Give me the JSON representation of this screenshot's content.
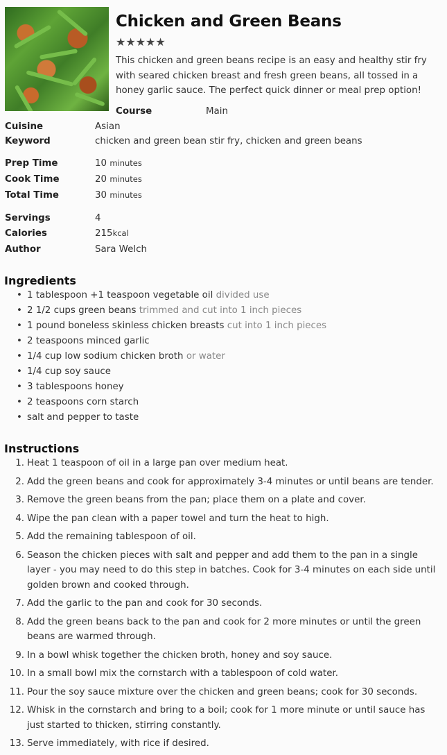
{
  "recipe": {
    "title": "Chicken and Green Beans",
    "rating_stars": "★★★★★",
    "summary": "This chicken and green beans recipe is an easy and healthy stir fry with seared chicken breast and fresh green beans, all tossed in a honey garlic sauce. The perfect quick dinner or meal prep option!"
  },
  "meta": {
    "course_label": "Course",
    "course": "Main",
    "cuisine_label": "Cuisine",
    "cuisine": "Asian",
    "keyword_label": "Keyword",
    "keyword": "chicken and green bean stir fry, chicken and green beans",
    "prep_label": "Prep Time",
    "prep_value": "10",
    "prep_unit": "minutes",
    "cook_label": "Cook Time",
    "cook_value": "20",
    "cook_unit": "minutes",
    "total_label": "Total Time",
    "total_value": "30",
    "total_unit": "minutes",
    "servings_label": "Servings",
    "servings": "4",
    "calories_label": "Calories",
    "calories_value": "215",
    "calories_unit": "kcal",
    "author_label": "Author",
    "author": "Sara Welch"
  },
  "ingredients_heading": "Ingredients",
  "ingredients": [
    {
      "text": "1 tablespoon +1 teaspoon vegetable oil",
      "note": "divided use"
    },
    {
      "text": "2 1/2 cups green beans",
      "note": "trimmed and cut into 1 inch pieces"
    },
    {
      "text": "1 pound boneless skinless chicken breasts",
      "note": "cut into 1 inch pieces"
    },
    {
      "text": "2 teaspoons minced garlic",
      "note": ""
    },
    {
      "text": "1/4 cup low sodium chicken broth",
      "note": "or water"
    },
    {
      "text": "1/4 cup soy sauce",
      "note": ""
    },
    {
      "text": "3 tablespoons honey",
      "note": ""
    },
    {
      "text": "2 teaspoons corn starch",
      "note": ""
    },
    {
      "text": "salt and pepper to taste",
      "note": ""
    }
  ],
  "instructions_heading": "Instructions",
  "instructions": [
    {
      "num": "1.",
      "text": "Heat 1 teaspoon of oil in a large pan over medium heat."
    },
    {
      "num": "2.",
      "text": "Add the green beans and cook for approximately 3-4 minutes or until beans are tender."
    },
    {
      "num": "3.",
      "text": "Remove the green beans from the pan; place them on a plate and cover."
    },
    {
      "num": "4.",
      "text": "Wipe the pan clean with a paper towel and turn the heat to high."
    },
    {
      "num": "5.",
      "text": "Add the remaining tablespoon of oil."
    },
    {
      "num": "6.",
      "text": "Season the chicken pieces with salt and pepper and add them to the pan in a single layer - you may need to do this step in batches. Cook for 3-4 minutes on each side until golden brown and cooked through."
    },
    {
      "num": "7.",
      "text": "Add the garlic to the pan and cook for 30 seconds."
    },
    {
      "num": "8.",
      "text": "Add the green beans back to the pan and cook for 2 more minutes or until the green beans are warmed through."
    },
    {
      "num": "9.",
      "text": "In a bowl whisk together the chicken broth, honey and soy sauce."
    },
    {
      "num": "10.",
      "text": "In a small bowl mix the cornstarch with a tablespoon of cold water."
    },
    {
      "num": "11.",
      "text": "Pour the soy sauce mixture over the chicken and green beans; cook for 30 seconds."
    },
    {
      "num": "12.",
      "text": "Whisk in the cornstarch and bring to a boil; cook for 1 more minute or until sauce has just started to thicken, stirring constantly."
    },
    {
      "num": "13.",
      "text": "Serve immediately, with rice if desired."
    }
  ]
}
